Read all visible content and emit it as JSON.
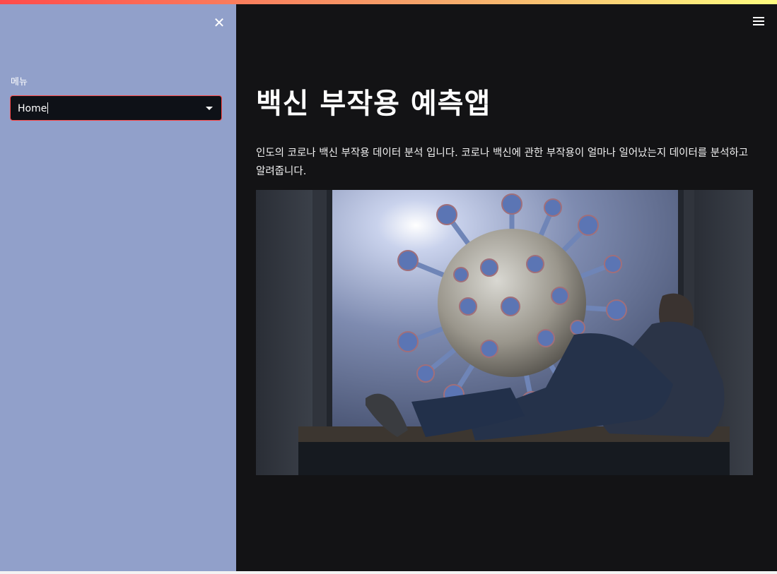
{
  "sidebar": {
    "label": "메뉴",
    "select": {
      "value": "Home"
    }
  },
  "main": {
    "title": "백신 부작용 예측앱",
    "intro": "인도의 코로나 백신 부작용 데이터 분석 입니다. 코로나 백신에 관한 부작용이 얼마나 일어났는지 데이터를 분석하고 알려줍니다."
  },
  "icons": {
    "close": "close-icon",
    "menu": "hamburger-menu-icon",
    "caret": "chevron-down-icon"
  },
  "colors": {
    "sidebar_bg": "#91a0ca",
    "main_bg": "#131315",
    "accent": "#ff4b4b"
  }
}
